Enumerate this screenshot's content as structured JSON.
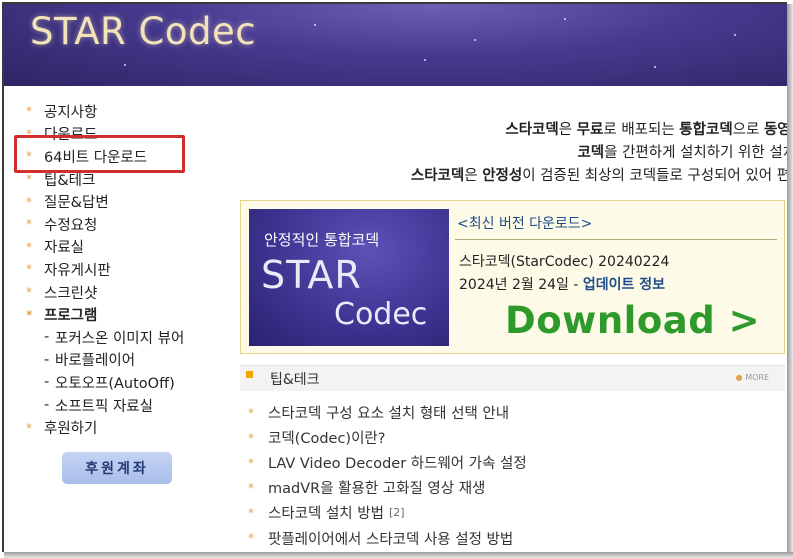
{
  "header": {
    "logo": "STAR Codec"
  },
  "sidebar": {
    "items": [
      {
        "label": "공지사항"
      },
      {
        "label": "다운로드"
      },
      {
        "label": "64비트 다운로드"
      },
      {
        "label": "팁&테크"
      },
      {
        "label": "질문&답변"
      },
      {
        "label": "수정요청"
      },
      {
        "label": "자료실"
      },
      {
        "label": "자유게시판"
      },
      {
        "label": "스크린샷"
      },
      {
        "label": "프로그램"
      }
    ],
    "sub_items": [
      {
        "label": "포커스온 이미지 뷰어"
      },
      {
        "label": "바로플레이어"
      },
      {
        "label": "오토오프(AutoOff)"
      },
      {
        "label": "소프트픽 자료실"
      }
    ],
    "last_item": {
      "label": "후원하기"
    },
    "donate_button": "후원계좌"
  },
  "intro": {
    "line1": {
      "a": "스타코덱",
      "b": "은 ",
      "c": "무료",
      "d": "로 배포되는 ",
      "e": "통합코덱",
      "f": "으로 ",
      "g": "동영상"
    },
    "line2": {
      "a": "코덱",
      "b": "을 간편하게 설치하기 위한 설치"
    },
    "line3": {
      "a": "스타코덱",
      "b": "은 ",
      "c": "안정성",
      "d": "이 검증된 최상의 코덱들로 구성되어 있어 편"
    }
  },
  "download": {
    "image": {
      "tagline": "안정적인 통합코덱",
      "word1": "STAR",
      "word2": "Codec"
    },
    "title": "<최신 버전 다운로드>",
    "version": "스타코덱(StarCodec) 20240224",
    "date": "2024년 2월 24일 - ",
    "update_link": "업데이트 정보",
    "button": "Download >"
  },
  "tips": {
    "title": "팁&테크",
    "more": "MORE",
    "items": [
      {
        "label": "스타코덱 구성 요소 설치 형태 선택 안내",
        "count": ""
      },
      {
        "label": "코덱(Codec)이란?",
        "count": ""
      },
      {
        "label": "LAV Video Decoder 하드웨어 가속 설정",
        "count": ""
      },
      {
        "label": "madVR을 활용한 고화질 영상 재생",
        "count": ""
      },
      {
        "label": "스타코덱 설치 방법",
        "count": "[2]"
      },
      {
        "label": "팟플레이어에서 스타코덱 사용 설정 방법",
        "count": ""
      }
    ]
  },
  "colors": {
    "highlight_box": "#d22e2e",
    "download_green": "#2f9a2c",
    "link_blue": "#1f4c86",
    "bullet": "#e6a24a"
  }
}
